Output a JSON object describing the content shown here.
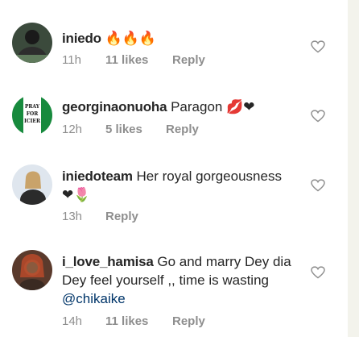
{
  "comments": [
    {
      "username": "iniedo",
      "text": " 🔥🔥🔥",
      "time": "11h",
      "likes": "11 likes",
      "reply": "Reply"
    },
    {
      "username": "georginaonuoha",
      "text": " Paragon 💋❤",
      "time": "12h",
      "likes": "5 likes",
      "reply": "Reply",
      "avatar_text": "PRAY FOR ICIER"
    },
    {
      "username": "iniedoteam",
      "text": " Her royal gorgeousness ❤🌷",
      "time": "13h",
      "reply": "Reply"
    },
    {
      "username": "i_love_hamisa",
      "text": " Go and marry Dey dia Dey feel yourself ,, time is wasting ",
      "mention": "@chikaike",
      "time": "14h",
      "likes": "11 likes",
      "reply": "Reply"
    }
  ],
  "colors": {
    "meta": "#8e8e8e",
    "mention": "#003569",
    "heart_outline": "#8e8e8e"
  }
}
